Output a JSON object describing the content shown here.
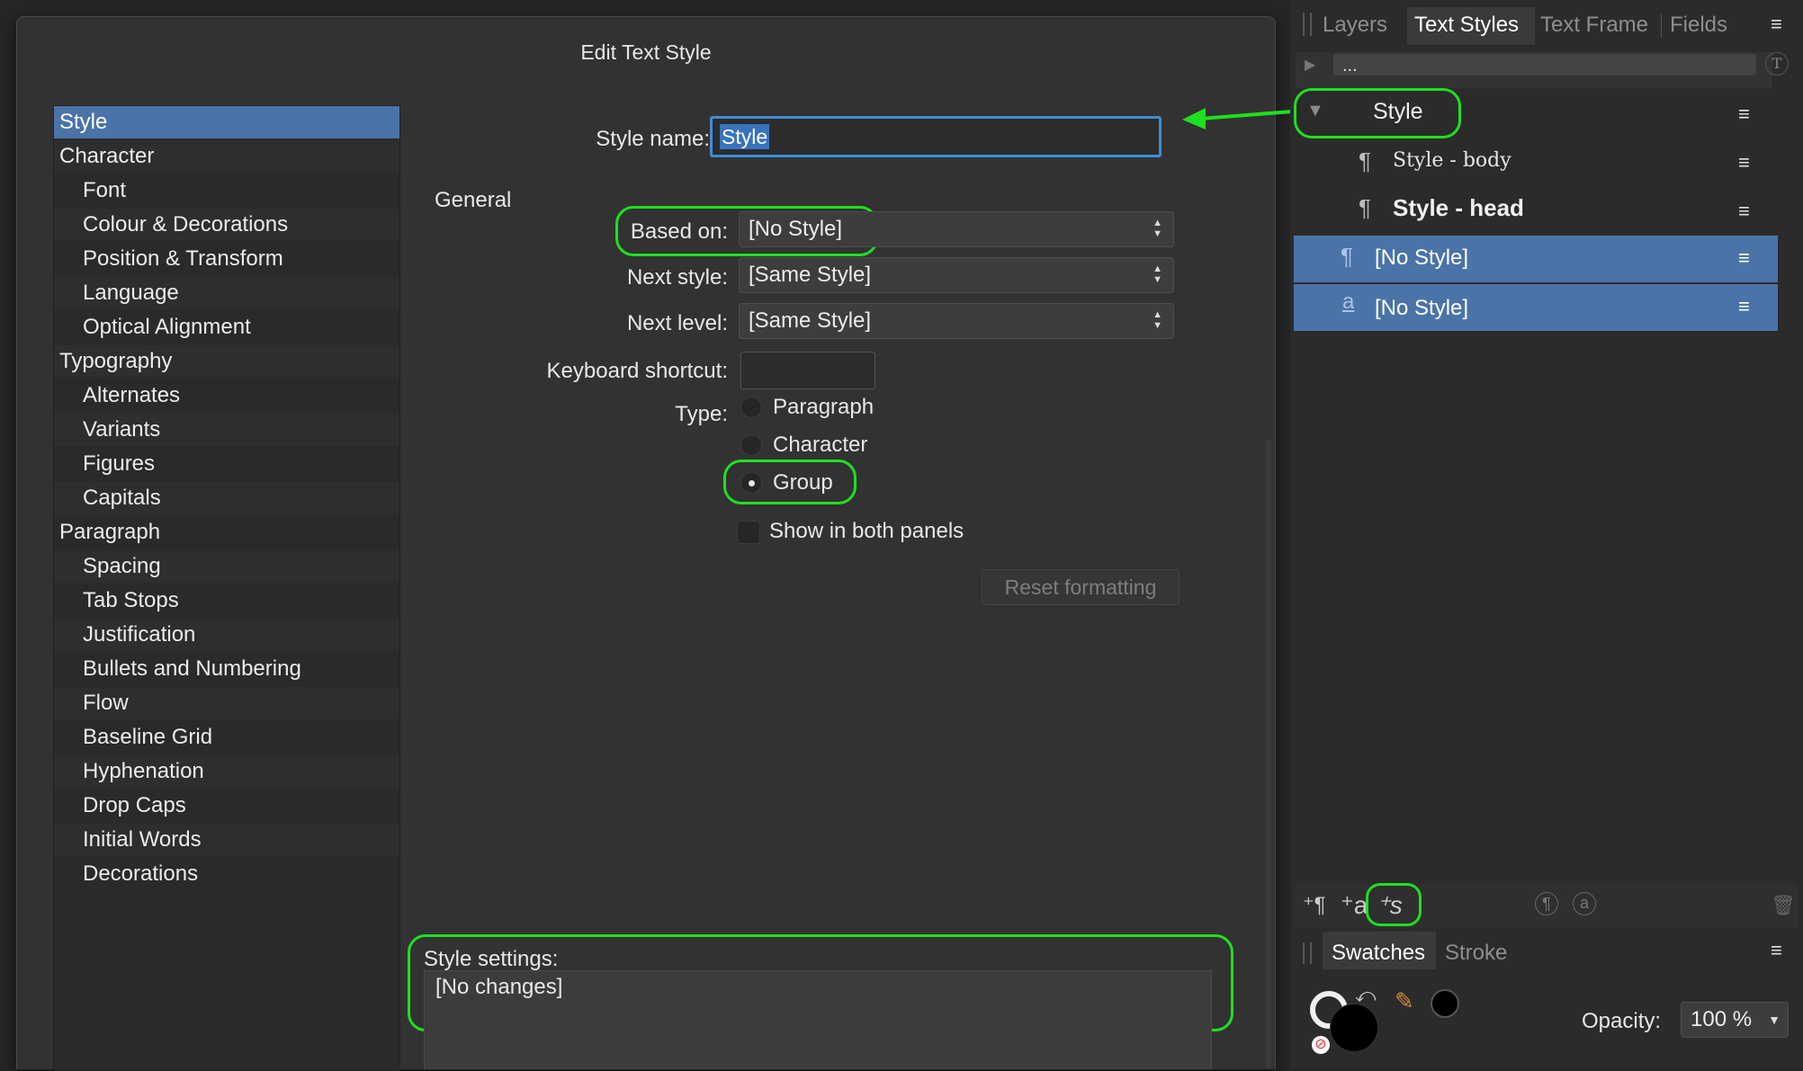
{
  "dialog": {
    "title": "Edit Text Style",
    "categories": [
      {
        "label": "Style",
        "indent": false
      },
      {
        "label": "Character",
        "indent": false
      },
      {
        "label": "Font",
        "indent": true
      },
      {
        "label": "Colour & Decorations",
        "indent": true
      },
      {
        "label": "Position & Transform",
        "indent": true
      },
      {
        "label": "Language",
        "indent": true
      },
      {
        "label": "Optical Alignment",
        "indent": true
      },
      {
        "label": "Typography",
        "indent": false
      },
      {
        "label": "Alternates",
        "indent": true
      },
      {
        "label": "Variants",
        "indent": true
      },
      {
        "label": "Figures",
        "indent": true
      },
      {
        "label": "Capitals",
        "indent": true
      },
      {
        "label": "Paragraph",
        "indent": false
      },
      {
        "label": "Spacing",
        "indent": true
      },
      {
        "label": "Tab Stops",
        "indent": true
      },
      {
        "label": "Justification",
        "indent": true
      },
      {
        "label": "Bullets and Numbering",
        "indent": true
      },
      {
        "label": "Flow",
        "indent": true
      },
      {
        "label": "Baseline Grid",
        "indent": true
      },
      {
        "label": "Hyphenation",
        "indent": true
      },
      {
        "label": "Drop Caps",
        "indent": true
      },
      {
        "label": "Initial Words",
        "indent": true
      },
      {
        "label": "Decorations",
        "indent": true
      }
    ],
    "selected_category": "Style",
    "style_name_label": "Style name:",
    "style_name_value": "Style",
    "general_heading": "General",
    "based_on_label": "Based on:",
    "based_on_value": "[No Style]",
    "next_style_label": "Next style:",
    "next_style_value": "[Same Style]",
    "next_level_label": "Next level:",
    "next_level_value": "[Same Style]",
    "keyboard_shortcut_label": "Keyboard shortcut:",
    "keyboard_shortcut_value": "",
    "type_label": "Type:",
    "type_options": [
      "Paragraph",
      "Character",
      "Group"
    ],
    "type_selected": "Group",
    "show_both_panels_label": "Show in both panels",
    "show_both_panels_checked": false,
    "reset_button_label": "Reset formatting",
    "style_settings_label": "Style settings:",
    "style_settings_value": "[No changes]"
  },
  "right_panel": {
    "tabs": [
      "Layers",
      "Text Styles",
      "Text Frame",
      "Fields"
    ],
    "active_tab": "Text Styles",
    "breadcrumb": "...",
    "styles": [
      {
        "label": "Style",
        "kind": "group"
      },
      {
        "label": "Style - body",
        "kind": "paragraph"
      },
      {
        "label": "Style - head",
        "kind": "paragraph"
      },
      {
        "label": "[No Style]",
        "kind": "paragraph"
      },
      {
        "label": "[No Style]",
        "kind": "character"
      }
    ],
    "swatches_tabs": [
      "Swatches",
      "Stroke"
    ],
    "active_swatches_tab": "Swatches",
    "opacity_label": "Opacity:",
    "opacity_value": "100 %"
  },
  "colors": {
    "selection": "#4a74a8",
    "highlight": "#1fe01f",
    "input_focus": "#3b8ed8"
  }
}
